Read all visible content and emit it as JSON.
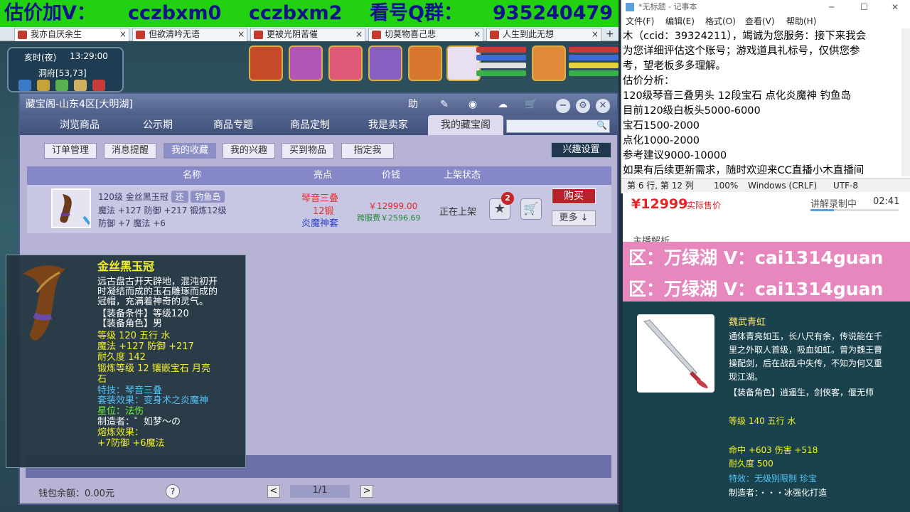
{
  "banner": {
    "text1": "估价加V：",
    "text2": "cczbxm0",
    "text3": "cczbxm2",
    "text4": "看号Q群：",
    "text5": "935240479"
  },
  "browser_tabs": [
    {
      "label": "我亦自厌余生",
      "active": true
    },
    {
      "label": "但欲清吟无语",
      "active": false
    },
    {
      "label": "更被光阴苦催",
      "active": false
    },
    {
      "label": "切莫物喜己悲",
      "active": false
    },
    {
      "label": "人生到此无想",
      "active": false
    }
  ],
  "tab_close": "×",
  "tab_plus": "+",
  "game_status": {
    "time_label": "亥时(夜)",
    "clock": "13:29:00",
    "location": "洞府[53,73]"
  },
  "window": {
    "title": "藏宝阁-山东4区[大明湖]",
    "help_label": "助",
    "minimize": "−",
    "settings": "⚙",
    "close": "✕"
  },
  "nav_tabs": [
    {
      "label": "浏览商品",
      "active": false
    },
    {
      "label": "公示期",
      "active": false
    },
    {
      "label": "商品专题",
      "active": false
    },
    {
      "label": "商品定制",
      "active": false
    },
    {
      "label": "我是卖家",
      "active": false
    },
    {
      "label": "我的藏宝阁",
      "active": true
    }
  ],
  "search": {
    "placeholder": "",
    "icon": "search-icon",
    "glyph": "🔍"
  },
  "sub_tabs": [
    {
      "label": "订单管理",
      "active": false
    },
    {
      "label": "消息提醒",
      "active": false
    },
    {
      "label": "我的收藏",
      "active": true
    },
    {
      "label": "我的兴趣",
      "active": false
    },
    {
      "label": "买到物品",
      "active": false
    },
    {
      "label": "指定我",
      "active": false
    }
  ],
  "interest_settings": "兴趣设置",
  "table": {
    "headers": [
      "名称",
      "亮点",
      "价钱",
      "上架状态"
    ],
    "row": {
      "level_name": "120级  金丝黑玉冠",
      "tag": "还",
      "server": "钓鱼岛",
      "stats1": "魔法 +127  防御 +217  锻炼12级",
      "stats2": "防御 +7  魔法 +6",
      "highlight1": "琴音三叠",
      "highlight2": "12锻",
      "highlight3": "炎魔神套",
      "price": "￥12999.00",
      "cross_fee": "跨服费￥2596.69",
      "status": "正在上架",
      "badge_count": "2",
      "star_glyph": "★",
      "cart_glyph": "🛒",
      "buy": "购买",
      "more": "更多 ↓"
    }
  },
  "footer": {
    "wallet": "钱包余额：0.00元",
    "help": "?",
    "prev": "<",
    "page": "1/1",
    "next": ">"
  },
  "tooltip": {
    "name": "金丝黑玉冠",
    "desc1": "远古盘古开天辟地，混沌初开",
    "desc2": "时凝结而成的玉石雕琢而成的",
    "desc3": "冠帽，充满着神奇的灵气。",
    "req_level": "【装备条件】等级120",
    "req_role": "【装备角色】男",
    "level_element": "等级 120  五行 水",
    "stats": "魔法 +127 防御 +217",
    "durability": "耐久度 142",
    "forge": "锻炼等级 12   镶嵌宝石 月亮",
    "forge2": "石",
    "special": "特技：琴音三叠",
    "set_effect": "套装效果：变身术之炎魔神",
    "star": "星位：法伤",
    "maker": "制造者：゜如梦～の",
    "melt": "熔炼效果：",
    "melt_val": "+7防御 +6魔法"
  },
  "notepad": {
    "title": "*无标题 - 记事本",
    "minimize": "─",
    "maximize": "☐",
    "close": "✕",
    "menu": [
      "文件(F)",
      "编辑(E)",
      "格式(O)",
      "查看(V)",
      "帮助(H)"
    ],
    "lines": [
      "木（ccid：39324211），竭诚为您服务：接下来我会",
      "为您详细评估这个账号；游戏道具礼标号，仅供您参",
      "考，望老板多多理解。",
      "估价分析：",
      "120级琴音三叠男头  12段宝石  点化炎魔神   钓鱼岛",
      "目前120级白板头5000-6000",
      "宝石1500-2000",
      "点化1000-2000",
      "参考建议9000-10000",
      "如果有后续更新需求，随时欢迎来CC直播小木直播间"
    ],
    "status": {
      "pos": "第 6 行, 第 12 列",
      "zoom": "100%",
      "eol": "Windows (CRLF)",
      "enc": "UTF-8"
    }
  },
  "overlay": {
    "price": "¥12999",
    "price_label": "实际售价",
    "record_label": "讲解录制中",
    "record_time": "02:41",
    "record_progress": 0.27,
    "anchor_label": "主播解析",
    "pink_line1": "区：万绿湖 V：cai1314guan",
    "pink_line2": "区：万绿湖 V：cai1314guan"
  },
  "right_item": {
    "name": "魏武青虹",
    "desc1": "通体青亮如玉，长八尺有余，传说能在千",
    "desc2": "里之外取人首级，吸血如虹。曾为魏王曹",
    "desc3": "操配剑，后在战乱中失传，不知为何又重",
    "desc4": "现江湖。",
    "role": "【装备角色】逍遥生，剑侠客，偃无师",
    "level": "等级 140 五行 水",
    "stats": "命中 +603 伤害 +518",
    "durability": "耐久度 500",
    "special": "特效：无级别限制 珍宝",
    "maker": "制造者：・・・冰强化打造"
  },
  "colors": {
    "banner_bg": "#22d10f",
    "banner_text": "#12128a",
    "price_red": "#e4262a",
    "tooltip_yellow": "#f3f02a",
    "tooltip_green": "#6ef53a",
    "tooltip_blue": "#4fc3f7"
  }
}
